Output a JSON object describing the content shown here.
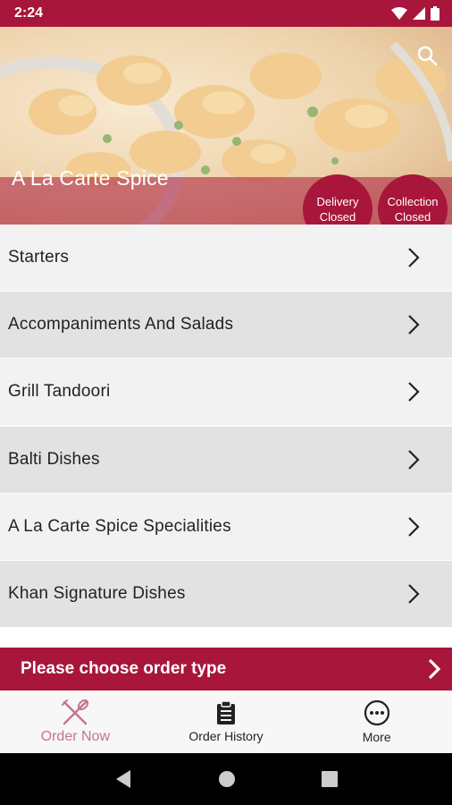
{
  "status_bar": {
    "time": "2:24",
    "icons": [
      "wifi-icon",
      "signal-icon",
      "battery-icon"
    ]
  },
  "hero": {
    "restaurant_name": "A La Carte Spice",
    "delivery_status": {
      "line1": "Delivery",
      "line2": "Closed"
    },
    "collection_status": {
      "line1": "Collection",
      "line2": "Closed"
    },
    "search_icon": "search-icon"
  },
  "menu": {
    "categories": [
      {
        "label": "Starters"
      },
      {
        "label": "Accompaniments And Salads"
      },
      {
        "label": "Grill Tandoori"
      },
      {
        "label": "Balti Dishes"
      },
      {
        "label": "A La Carte Spice Specialities"
      },
      {
        "label": "Khan Signature Dishes"
      }
    ]
  },
  "order_bar": {
    "label": "Please choose order type"
  },
  "bottom_nav": {
    "items": [
      {
        "label": "Order Now",
        "icon": "fork-knife-icon",
        "active": true
      },
      {
        "label": "Order History",
        "icon": "clipboard-icon",
        "active": false
      },
      {
        "label": "More",
        "icon": "more-icon",
        "active": false
      }
    ]
  },
  "colors": {
    "brand": "#a8163b",
    "active_nav": "#c8748a",
    "row_light": "#f2f2f2",
    "row_dark": "#e2e2e2"
  }
}
